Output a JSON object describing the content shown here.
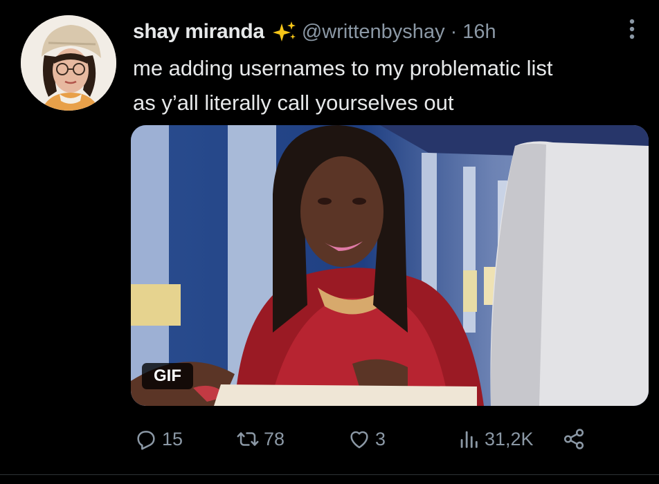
{
  "tweet": {
    "author": {
      "display_name": "shay miranda",
      "badge_icon": "sparkles-icon",
      "handle": "@writtenbyshay",
      "separator": "·",
      "time": "16h"
    },
    "text_lines": [
      "me adding usernames to my problematic list",
      "as y’all literally call yourselves out"
    ],
    "media": {
      "badge": "GIF"
    },
    "actions": {
      "replies": "15",
      "retweets": "78",
      "likes": "3",
      "views": "31,2K"
    }
  },
  "colors": {
    "background": "#000000",
    "primary_text": "#e7e9ea",
    "secondary_text": "#8b98a5",
    "sparkle": "#f5c518"
  }
}
